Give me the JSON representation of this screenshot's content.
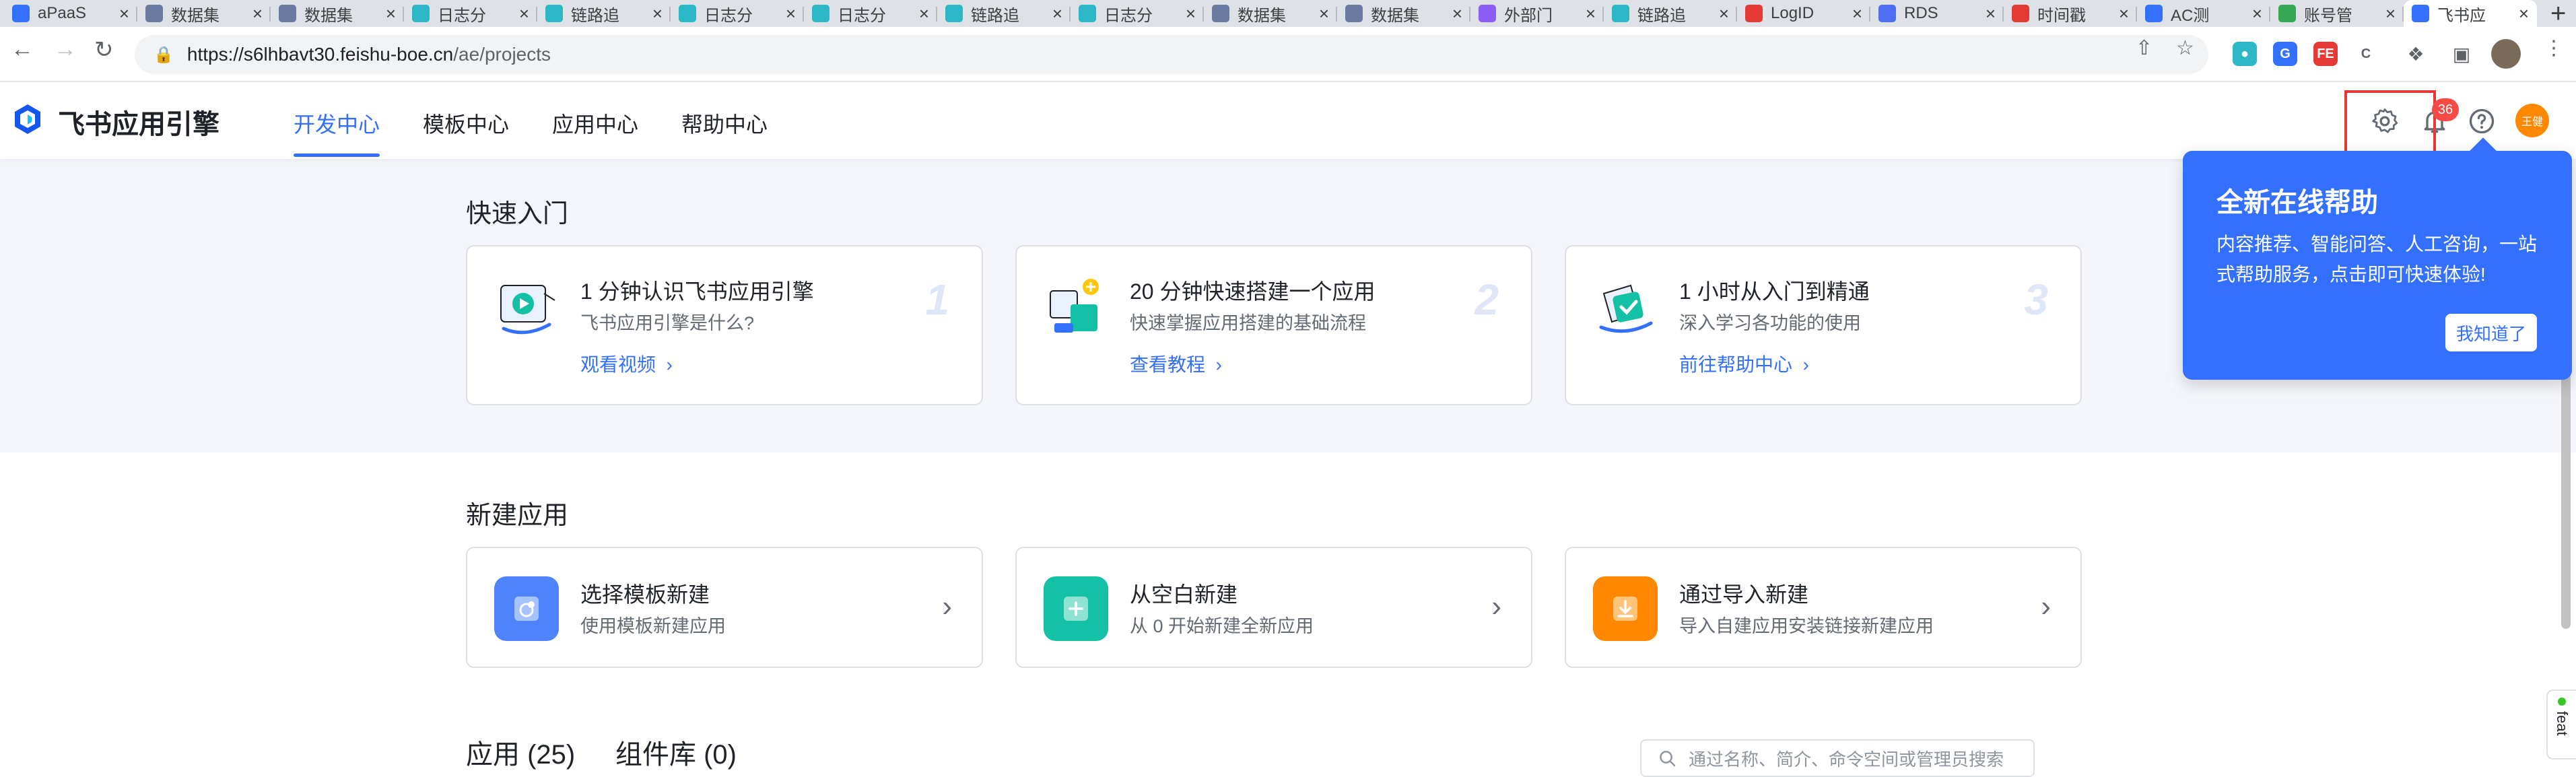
{
  "browser": {
    "tabs": [
      {
        "label": "aPaaS",
        "color": "#3370ff"
      },
      {
        "label": "数据集",
        "color": "#6b7aa0"
      },
      {
        "label": "数据集",
        "color": "#6b7aa0"
      },
      {
        "label": "日志分",
        "color": "#2bb7c6"
      },
      {
        "label": "链路追",
        "color": "#2bb7c6"
      },
      {
        "label": "日志分",
        "color": "#2bb7c6"
      },
      {
        "label": "日志分",
        "color": "#2bb7c6"
      },
      {
        "label": "链路追",
        "color": "#2bb7c6"
      },
      {
        "label": "日志分",
        "color": "#2bb7c6"
      },
      {
        "label": "数据集",
        "color": "#6b7aa0"
      },
      {
        "label": "数据集",
        "color": "#6b7aa0"
      },
      {
        "label": "外部门",
        "color": "#8b5cf6"
      },
      {
        "label": "链路追",
        "color": "#2bb7c6"
      },
      {
        "label": "LogID",
        "color": "#e53935"
      },
      {
        "label": "RDS",
        "color": "#4e6ef2"
      },
      {
        "label": "时间戳",
        "color": "#e53935"
      },
      {
        "label": "AC测",
        "color": "#3370ff"
      },
      {
        "label": "账号管",
        "color": "#34a853"
      },
      {
        "label": "飞书应",
        "color": "#3370ff"
      }
    ],
    "url_host": "https://s6lhbavt30.feishu-boe.cn",
    "url_path": "/ae/projects"
  },
  "app": {
    "brand": "飞书应用引擎",
    "nav": [
      "开发中心",
      "模板中心",
      "应用中心",
      "帮助中心"
    ],
    "notification_count": "36",
    "avatar_text": "王健"
  },
  "quick_start": {
    "title": "快速入门",
    "cards": [
      {
        "title": "1 分钟认识飞书应用引擎",
        "desc": "飞书应用引擎是什么?",
        "link": "观看视频",
        "num": "1"
      },
      {
        "title": "20 分钟快速搭建一个应用",
        "desc": "快速掌握应用搭建的基础流程",
        "link": "查看教程",
        "num": "2"
      },
      {
        "title": "1 小时从入门到精通",
        "desc": "深入学习各功能的使用",
        "link": "前往帮助中心",
        "num": "3"
      }
    ]
  },
  "new_app": {
    "title": "新建应用",
    "cards": [
      {
        "title": "选择模板新建",
        "desc": "使用模板新建应用",
        "color": "#4e83fd"
      },
      {
        "title": "从空白新建",
        "desc": "从 0 开始新建全新应用",
        "color": "#14c0a6"
      },
      {
        "title": "通过导入新建",
        "desc": "导入自建应用安装链接新建应用",
        "color": "#ff8800"
      }
    ]
  },
  "bottom": {
    "apps_tab": "应用 (25)",
    "components_tab": "组件库 (0)",
    "search_placeholder": "通过名称、简介、命令空间或管理员搜索"
  },
  "popover": {
    "title": "全新在线帮助",
    "body": "内容推荐、智能问答、人工咨询，一站式帮助服务，点击即可快速体验!",
    "button": "我知道了"
  },
  "feedback_label": "feat"
}
